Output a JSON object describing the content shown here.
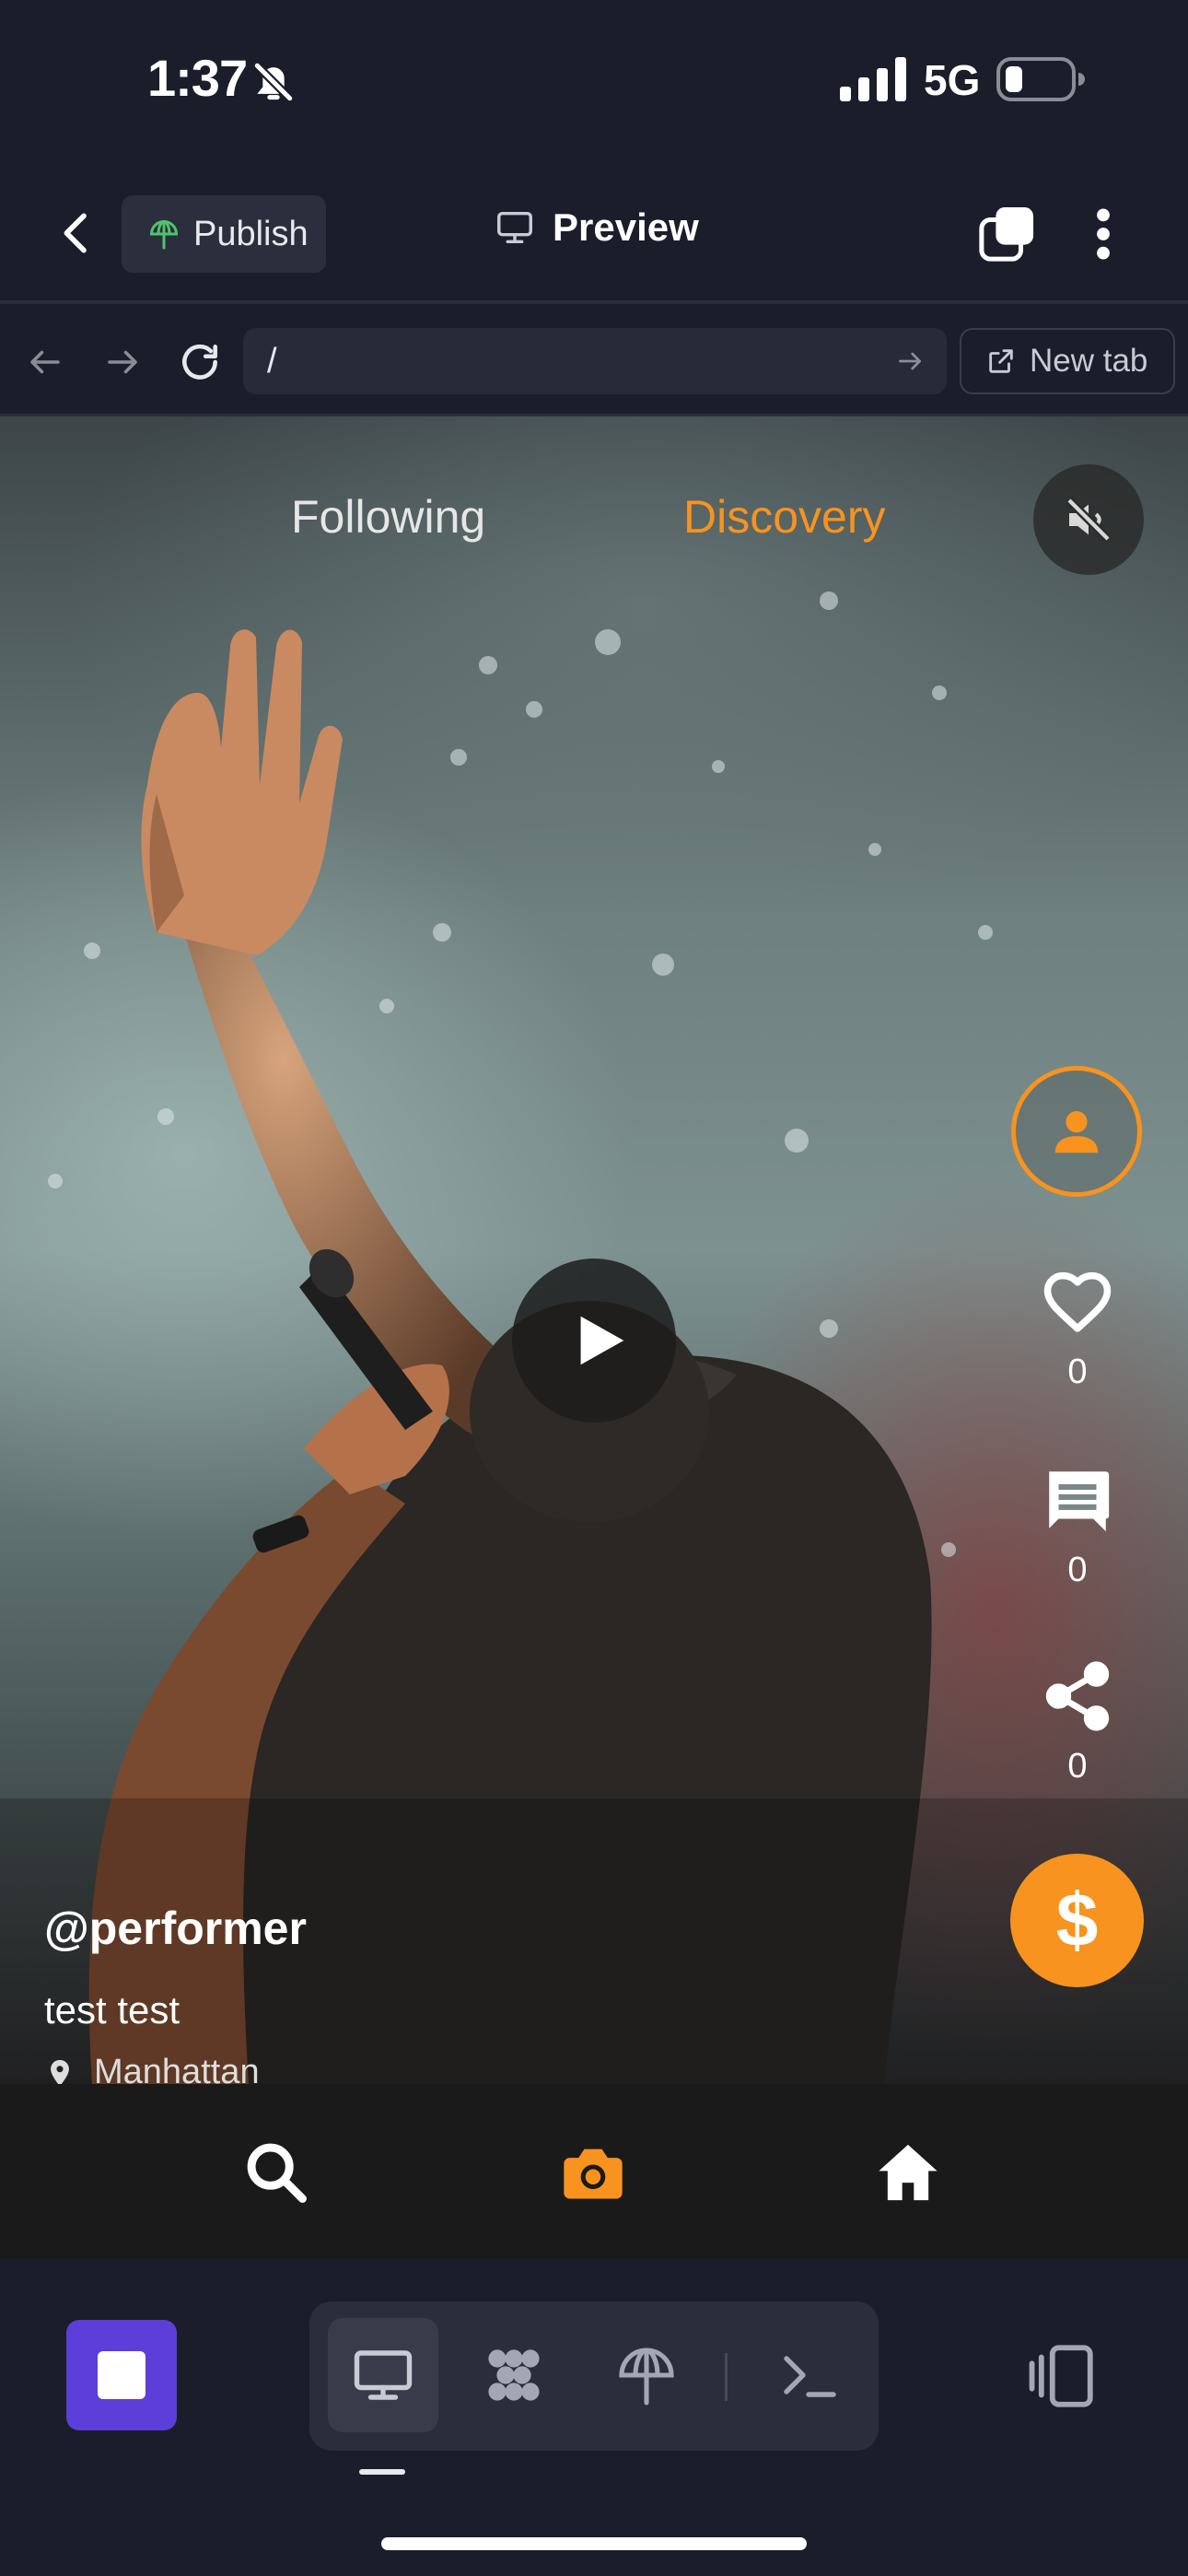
{
  "status_bar": {
    "time": "1:37",
    "network": "5G",
    "icons": [
      "bell-slash-icon",
      "signal-icon",
      "battery-icon"
    ]
  },
  "header": {
    "back_icon": "chevron-left-icon",
    "publish_label": "Publish",
    "title": "Preview",
    "tabs_icon": "tabs-icon",
    "more_icon": "more-vertical-icon"
  },
  "browser": {
    "url": "/",
    "new_tab_label": "New tab",
    "icons": [
      "arrow-left-icon",
      "arrow-right-icon",
      "reload-icon",
      "external-link-icon"
    ]
  },
  "feed": {
    "tabs": [
      {
        "label": "Following",
        "active": false
      },
      {
        "label": "Discovery",
        "active": true
      }
    ],
    "likes": "0",
    "comments": "0",
    "shares": "0",
    "tip_symbol": "$",
    "author": "@performer",
    "caption": "test test",
    "location": "Manhattan"
  },
  "app_nav": {
    "items": [
      "search-icon",
      "camera-icon",
      "home-icon"
    ],
    "active": "camera-icon"
  },
  "toolbar": {
    "tools": [
      "desktop-icon",
      "grid-icon",
      "deploy-icon",
      "terminal-icon"
    ],
    "active": "desktop-icon"
  },
  "colors": {
    "accent": "#f7931e",
    "background": "#1b1d2a",
    "stop_button": "#5b3fd8"
  }
}
